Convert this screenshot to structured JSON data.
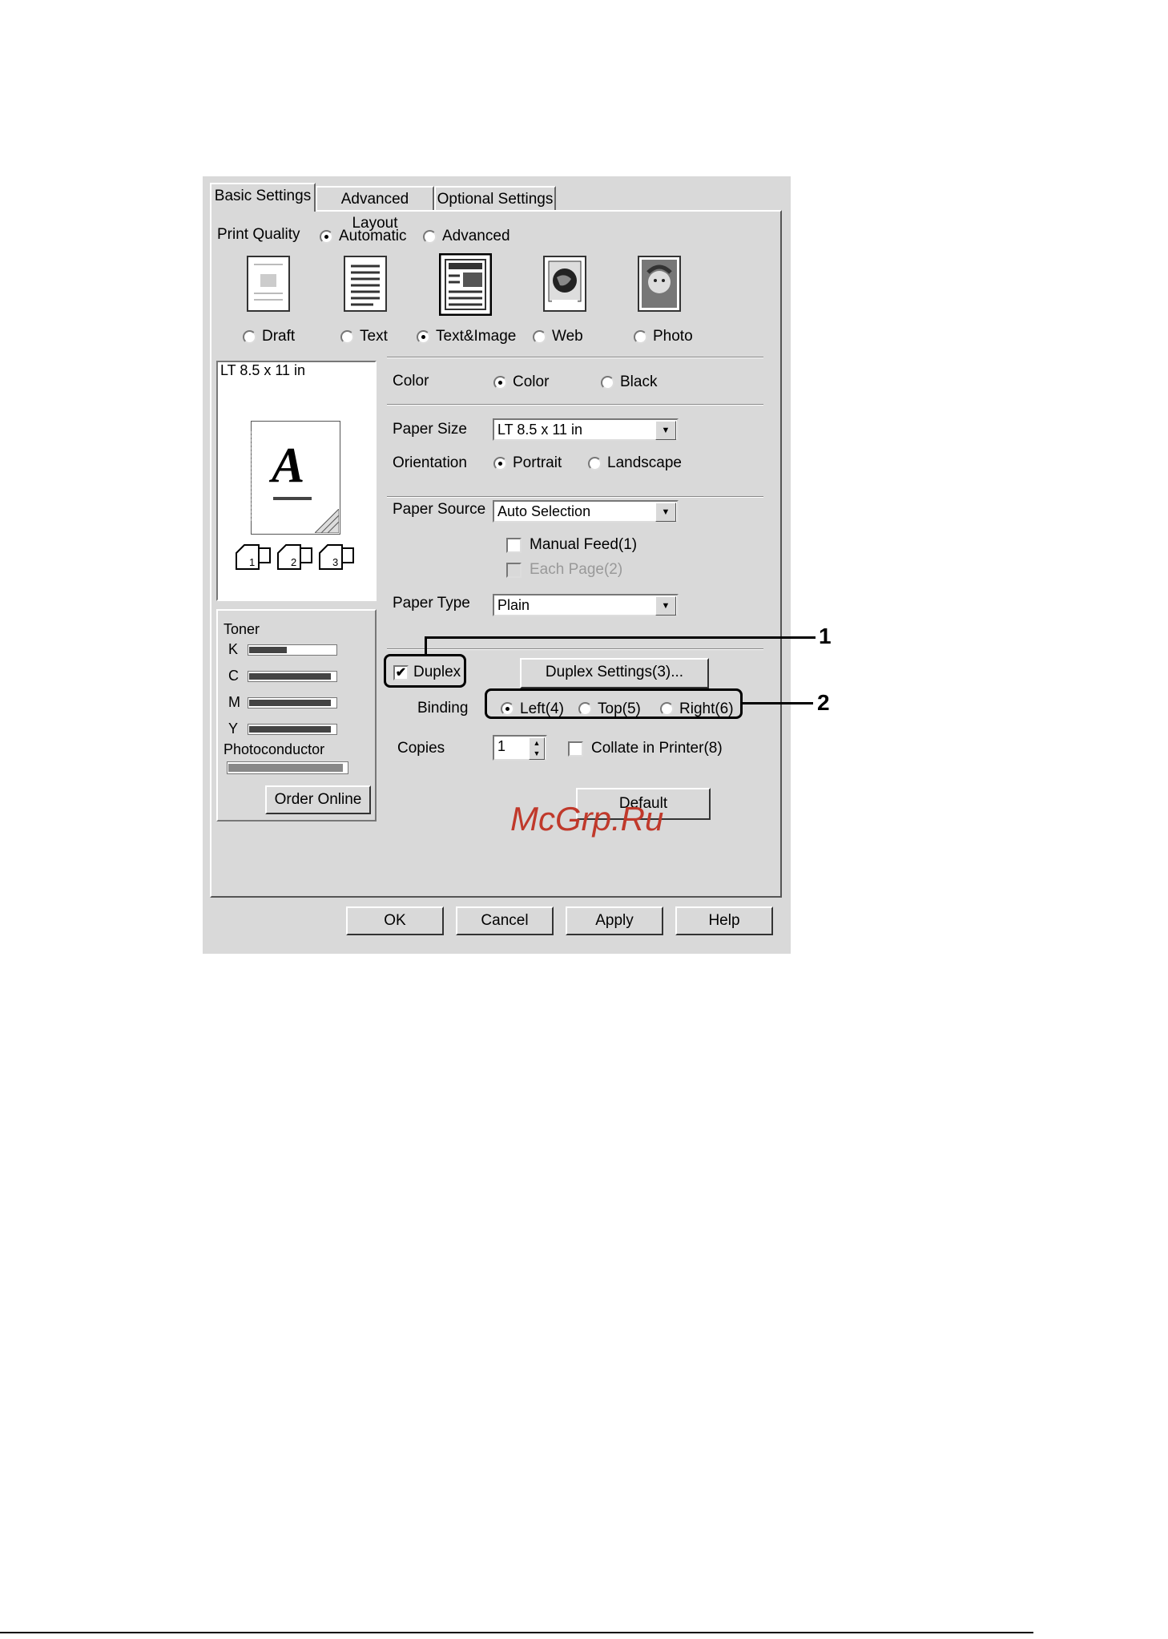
{
  "tabs": [
    "Basic Settings",
    "Advanced Layout",
    "Optional Settings"
  ],
  "print_quality": {
    "label": "Print Quality",
    "automatic": "Automatic",
    "advanced": "Advanced",
    "modes": [
      "Draft",
      "Text",
      "Text&Image",
      "Web",
      "Photo"
    ],
    "selected": "Text&Image"
  },
  "preview": {
    "paper": "LT 8.5 x 11 in",
    "letter": "A",
    "page_numbers": [
      "1",
      "2",
      "3"
    ]
  },
  "color": {
    "label": "Color",
    "color": "Color",
    "black": "Black"
  },
  "paper_size": {
    "label": "Paper Size",
    "value": "LT 8.5 x 11 in"
  },
  "orientation": {
    "label": "Orientation",
    "portrait": "Portrait",
    "landscape": "Landscape"
  },
  "paper_source": {
    "label": "Paper Source",
    "value": "Auto Selection",
    "manual_feed": "Manual Feed(1)",
    "each_page": "Each Page(2)"
  },
  "paper_type": {
    "label": "Paper Type",
    "value": "Plain"
  },
  "duplex": {
    "label": "Duplex",
    "settings_button": "Duplex Settings(3)..."
  },
  "binding": {
    "label": "Binding",
    "left": "Left(4)",
    "top": "Top(5)",
    "right": "Right(6)"
  },
  "copies": {
    "label": "Copies",
    "value": "1",
    "collate": "Collate in Printer(8)"
  },
  "toner": {
    "label": "Toner",
    "levels": [
      {
        "name": "K",
        "fraction": 0.45
      },
      {
        "name": "C",
        "fraction": 0.95
      },
      {
        "name": "M",
        "fraction": 0.95
      },
      {
        "name": "Y",
        "fraction": 0.95
      }
    ],
    "photoconductor_label": "Photoconductor",
    "photoconductor_fraction": 0.97,
    "order_online": "Order Online"
  },
  "default_button": "Default",
  "buttons": {
    "ok": "OK",
    "cancel": "Cancel",
    "apply": "Apply",
    "help": "Help"
  },
  "callouts": [
    "1",
    "2"
  ],
  "watermark": "McGrp.Ru"
}
